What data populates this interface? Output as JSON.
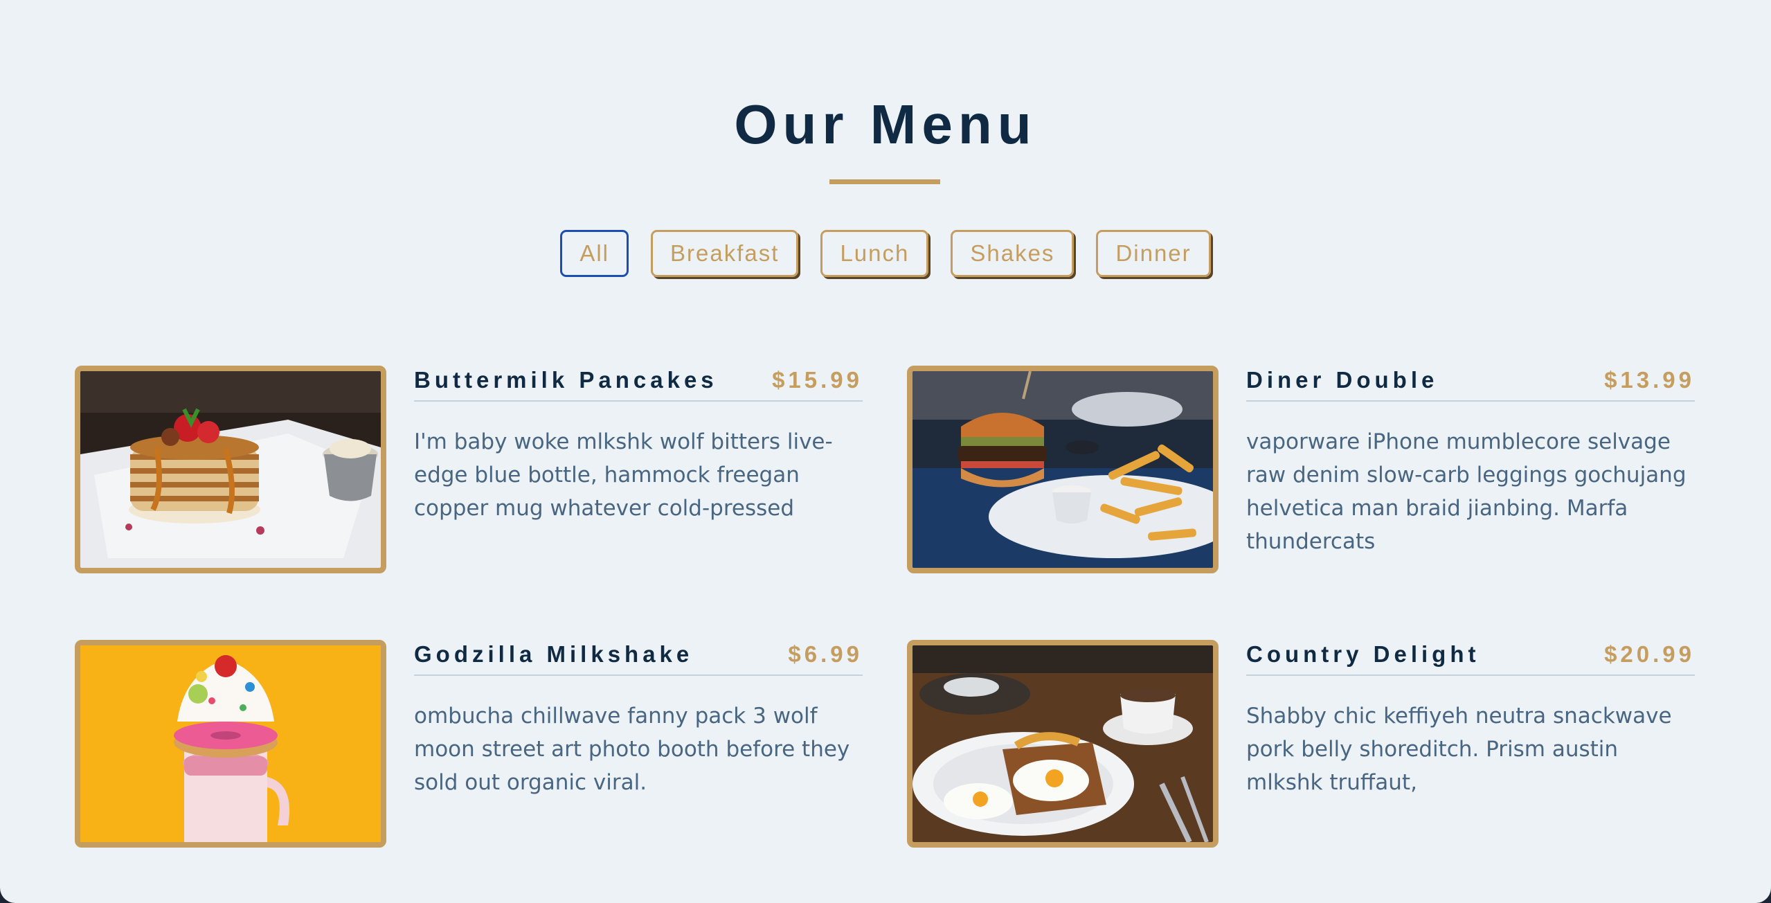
{
  "title": "Our Menu",
  "filters": [
    {
      "label": "All",
      "active": true
    },
    {
      "label": "Breakfast",
      "active": false
    },
    {
      "label": "Lunch",
      "active": false
    },
    {
      "label": "Shakes",
      "active": false
    },
    {
      "label": "Dinner",
      "active": false
    }
  ],
  "items": [
    {
      "name": "Buttermilk Pancakes",
      "price": "$15.99",
      "description": "I'm baby woke mlkshk wolf bitters live-edge blue bottle, hammock freegan copper mug whatever cold-pressed",
      "image": "pancakes-photo"
    },
    {
      "name": "Diner Double",
      "price": "$13.99",
      "description": "vaporware iPhone mumblecore selvage raw denim slow-carb leggings gochujang helvetica man braid jianbing. Marfa thundercats",
      "image": "burger-photo"
    },
    {
      "name": "Godzilla Milkshake",
      "price": "$6.99",
      "description": "ombucha chillwave fanny pack 3 wolf moon street art photo booth before they sold out organic viral.",
      "image": "milkshake-photo"
    },
    {
      "name": "Country Delight",
      "price": "$20.99",
      "description": "Shabby chic keffiyeh neutra snackwave pork belly shoreditch. Prism austin mlkshk truffaut,",
      "image": "breakfast-plate-photo"
    }
  ],
  "colors": {
    "accent": "#c59d5f",
    "heading": "#102a43",
    "text": "#486581",
    "background": "#edf2f6",
    "active_border": "#1c4eb1"
  }
}
